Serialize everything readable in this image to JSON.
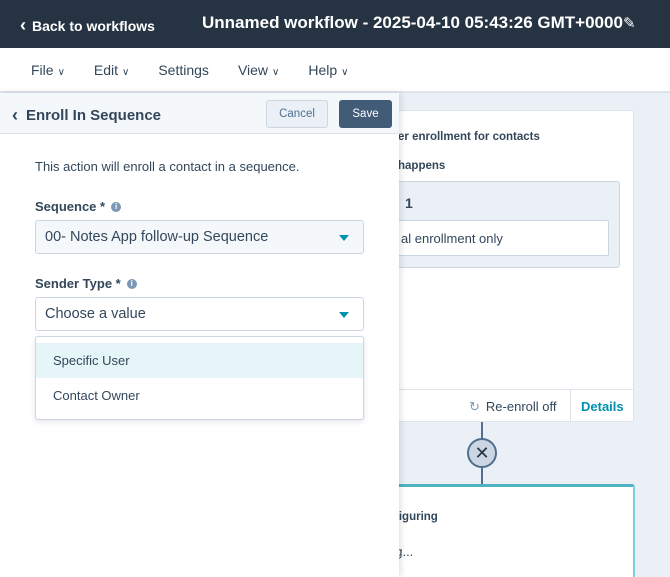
{
  "topbar": {
    "back_label": "Back to workflows",
    "title": "Unnamed workflow - 2025-04-10 05:43:26 GMT+0000"
  },
  "menubar": {
    "items": [
      {
        "label": "File",
        "has_dropdown": true
      },
      {
        "label": "Edit",
        "has_dropdown": true
      },
      {
        "label": "Settings",
        "has_dropdown": false
      },
      {
        "label": "View",
        "has_dropdown": true
      },
      {
        "label": "Help",
        "has_dropdown": true
      }
    ]
  },
  "panel": {
    "title": "Enroll In Sequence",
    "cancel_label": "Cancel",
    "save_label": "Save",
    "description": "This action will enroll a contact in a sequence.",
    "sequence": {
      "label": "Sequence *",
      "value": "00- Notes App follow-up Sequence"
    },
    "sender_type": {
      "label": "Sender Type *",
      "placeholder": "Choose a value",
      "options": [
        "Specific User",
        "Contact Owner"
      ],
      "highlighted": "Specific User"
    }
  },
  "canvas": {
    "trigger_card": {
      "heading": "er enrollment for contacts",
      "subheading": "happens",
      "group_number": "1",
      "filter_text": "al enrollment only",
      "reenroll_label": "Re-enroll off",
      "details_label": "Details"
    },
    "action_card": {
      "heading": "nfiguring",
      "body": "ng..."
    }
  },
  "colors": {
    "topbar": "#253342",
    "accent": "#0091ae",
    "save_button": "#425b76",
    "highlight": "#e5f5f8"
  }
}
